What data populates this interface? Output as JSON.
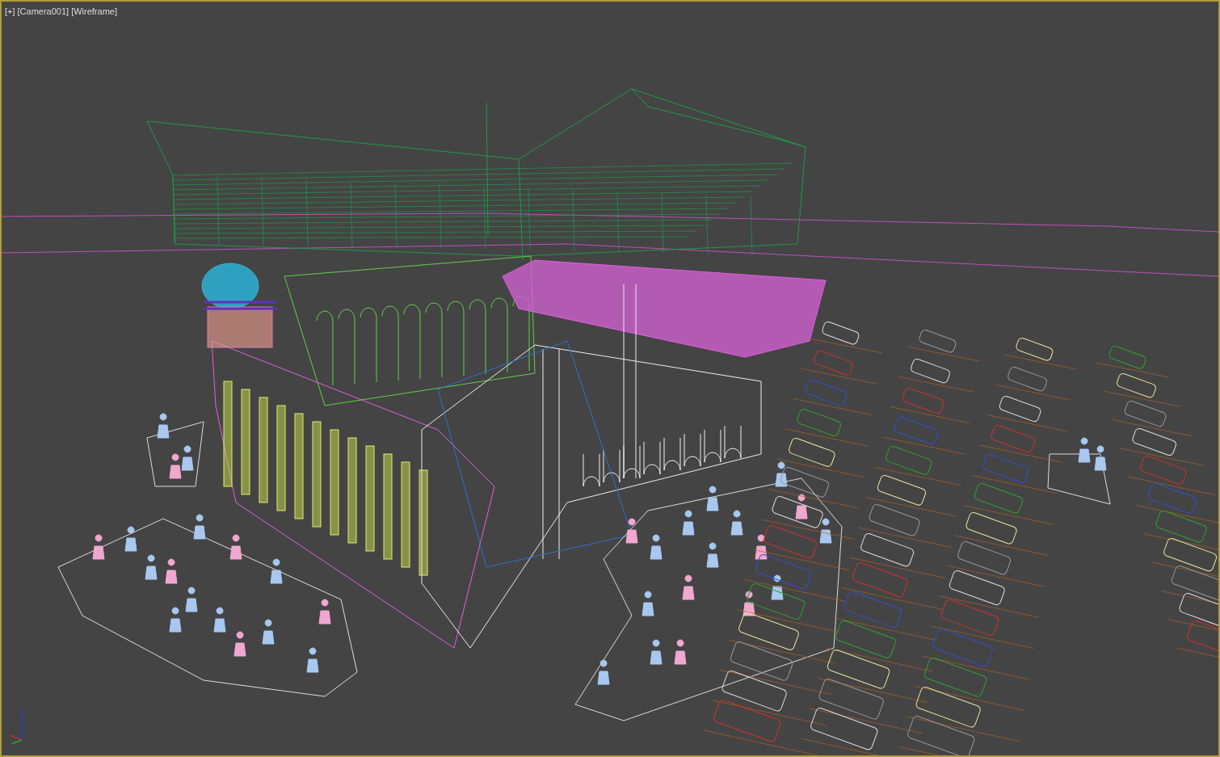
{
  "viewport": {
    "active": true,
    "labels": [
      {
        "text": "[+]"
      },
      {
        "text": "[Camera001]"
      },
      {
        "text": "[Wireframe]"
      }
    ],
    "axis_gizmo": {
      "label": "z"
    }
  }
}
